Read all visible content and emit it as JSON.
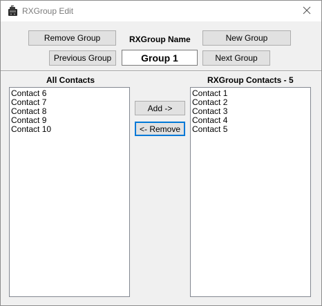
{
  "window": {
    "title": "RXGroup Edit"
  },
  "toolbar": {
    "remove_group": "Remove Group",
    "group_name_label": "RXGroup Name",
    "new_group": "New Group",
    "previous_group": "Previous Group",
    "group_name_value": "Group 1",
    "next_group": "Next Group"
  },
  "all_contacts": {
    "header": "All Contacts",
    "items": [
      "Contact 6",
      "Contact 7",
      "Contact 8",
      "Contact 9",
      "Contact 10"
    ]
  },
  "group_contacts": {
    "header": "RXGroup Contacts - 5",
    "items": [
      "Contact 1",
      "Contact 2",
      "Contact 3",
      "Contact 4",
      "Contact 5"
    ]
  },
  "actions": {
    "add": "Add ->",
    "remove": "<- Remove"
  },
  "icons": {
    "app": "radio-icon",
    "close": "close-icon"
  }
}
